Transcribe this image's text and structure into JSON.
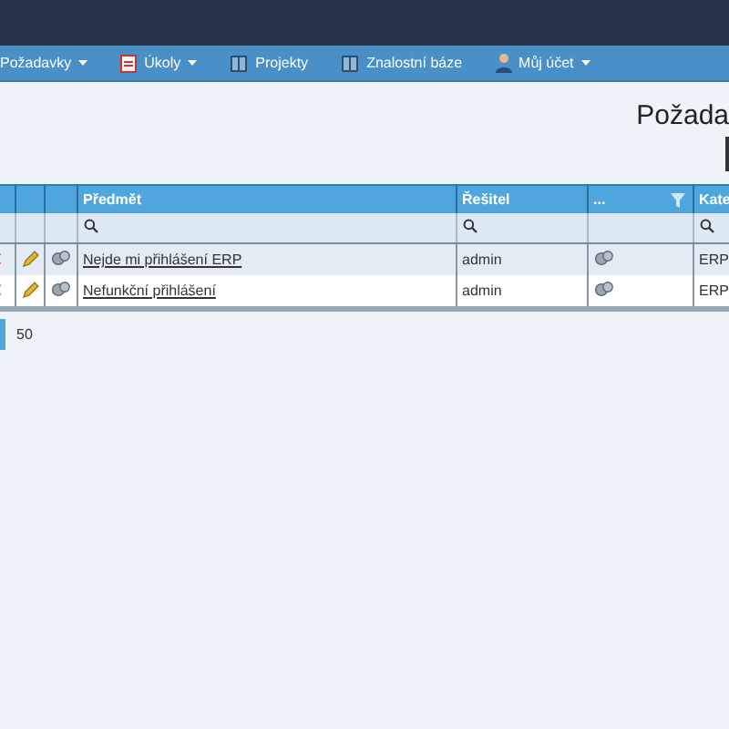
{
  "nav": [
    {
      "label": "Požadavky"
    },
    {
      "label": "Úkoly"
    },
    {
      "label": "Projekty"
    },
    {
      "label": "Znalostní báze"
    },
    {
      "label": "Můj účet"
    }
  ],
  "page_title": "Požada",
  "table": {
    "columns": [
      {},
      {},
      {},
      {
        "label": "Předmět"
      },
      {
        "label": "Řešitel"
      },
      {
        "label": "..."
      },
      {
        "label": "Kate"
      }
    ],
    "rows": [
      {
        "subject": "Nejde mi přihlášení ERP",
        "solver": "admin",
        "category": "ERP"
      },
      {
        "subject": "Nefunkční přihlášení",
        "solver": "admin",
        "category": "ERP"
      }
    ]
  },
  "pager": {
    "page_size": "50"
  }
}
